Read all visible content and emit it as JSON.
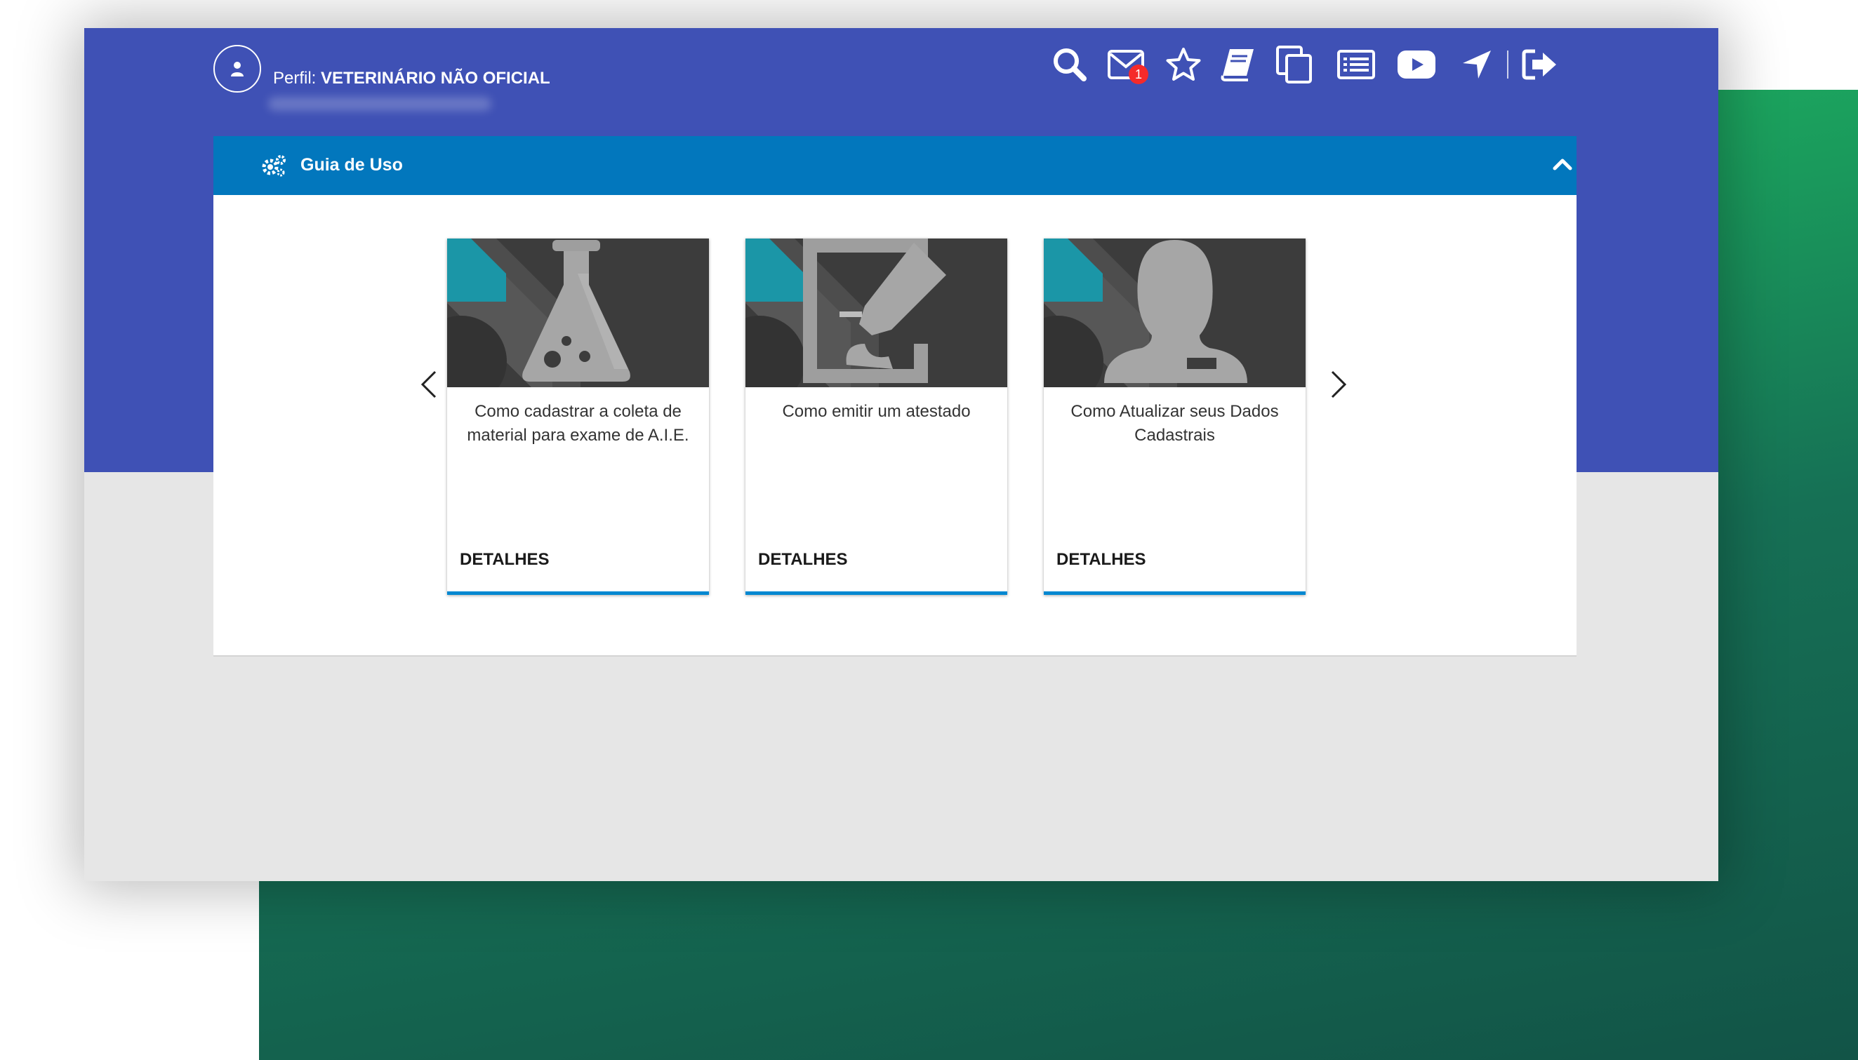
{
  "header": {
    "profile_label": "Perfil:",
    "profile_value": "VETERINÁRIO NÃO OFICIAL",
    "notification_count": "1",
    "toolbar_icons": [
      "search-icon",
      "mail-icon",
      "star-icon",
      "book-icon",
      "copy-icon",
      "list-icon",
      "youtube-icon",
      "location-arrow-icon",
      "logout-icon"
    ]
  },
  "guide": {
    "title": "Guia de Uso",
    "cards": [
      {
        "title": "Como cadastrar a coleta de material para exame de A.I.E.",
        "link": "DETALHES",
        "icon": "flask-icon"
      },
      {
        "title": "Como emitir um atestado",
        "link": "DETALHES",
        "icon": "edit-document-icon"
      },
      {
        "title": "Como Atualizar seus Dados Cadastrais",
        "link": "DETALHES",
        "icon": "user-profile-icon"
      }
    ]
  },
  "colors": {
    "header_blue": "#3f51b5",
    "panel_header": "#0277bd",
    "card_accent": "#0288d1",
    "badge_red": "#f52a2a",
    "green_gradient_start": "#21c064",
    "green_gradient_end": "#125447"
  }
}
